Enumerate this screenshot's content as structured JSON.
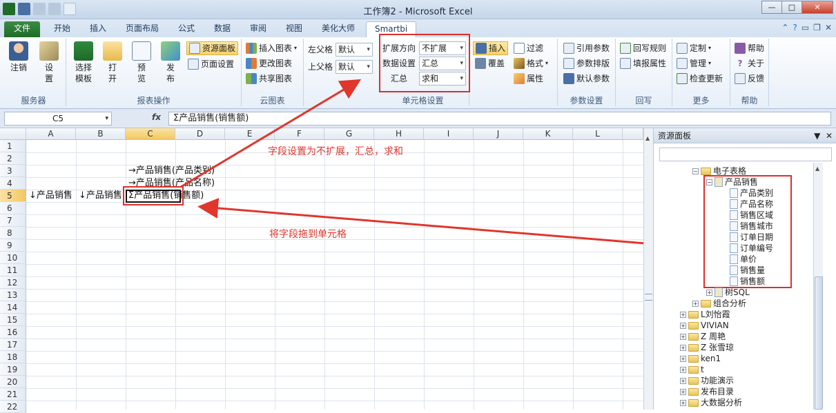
{
  "window": {
    "title": "工作簿2 - Microsoft Excel"
  },
  "tabs": [
    "文件",
    "开始",
    "插入",
    "页面布局",
    "公式",
    "数据",
    "审阅",
    "视图",
    "美化大师",
    "Smartbi"
  ],
  "ribbon": {
    "service": {
      "label": "服务器",
      "logout": "注销",
      "settings": "设\n置"
    },
    "report": {
      "label": "报表操作",
      "select_template": "选择\n模板",
      "open": "打\n开",
      "preview": "预\n览",
      "publish": "发\n布",
      "resource_panel": "资源面板",
      "page_settings": "页面设置"
    },
    "cloud": {
      "label": "云图表",
      "insert_chart": "插入图表",
      "change_chart": "更改图表",
      "share_chart": "共享图表"
    },
    "parent": {
      "left_parent": "左父格",
      "left_value": "默认",
      "top_parent": "上父格",
      "top_value": "默认"
    },
    "cell": {
      "label": "单元格设置",
      "expand_dir": "扩展方向",
      "expand_value": "不扩展",
      "data_setting": "数据设置",
      "data_value": "汇总",
      "summary": "汇总",
      "summary_value": "求和"
    },
    "misc": {
      "insert": "插入",
      "cover": "覆盖",
      "filter": "过滤",
      "format": "格式",
      "attribute": "属性"
    },
    "params": {
      "label": "参数设置",
      "ref_param": "引用参数",
      "param_layout": "参数排版",
      "default_param": "默认参数"
    },
    "writeback": {
      "label": "回写",
      "rules": "回写规则",
      "fill_attr": "填报属性"
    },
    "more": {
      "label": "更多",
      "custom": "定制",
      "manage": "管理",
      "check_update": "检查更新"
    },
    "help": {
      "label": "帮助",
      "help": "帮助",
      "about": "关于",
      "feedback": "反馈"
    }
  },
  "formula": {
    "name_box": "C5",
    "content": "Σ产品销售(销售额)"
  },
  "sheet": {
    "columns": [
      "A",
      "B",
      "C",
      "D",
      "E",
      "F",
      "G",
      "H",
      "I",
      "J",
      "K",
      "L"
    ],
    "rows": [
      "1",
      "2",
      "3",
      "4",
      "5",
      "6",
      "7",
      "8",
      "9",
      "10",
      "11",
      "12",
      "13",
      "14",
      "15",
      "16",
      "17",
      "18",
      "19",
      "20",
      "21",
      "22"
    ],
    "c3": "→产品销售(产品类别)",
    "c4": "→产品销售(产品名称)",
    "a5": "↓产品销售",
    "b5": "↓产品销售",
    "c5": "Σ产品销售(销售额)"
  },
  "annotations": {
    "top": "字段设置为不扩展，汇总，求和",
    "bottom": "将字段拖到单元格"
  },
  "panel": {
    "title": "资源面板",
    "tree": {
      "spreadsheet": "电子表格",
      "product_sales": "产品销售",
      "fields": [
        "产品类别",
        "产品名称",
        "销售区域",
        "销售城市",
        "订单日期",
        "订单编号",
        "单价",
        "销售量",
        "销售额"
      ],
      "tree_sql": "树SQL",
      "combo_analysis": "组合分析",
      "others": [
        "L刘怡霞",
        "VIVIAN",
        "Z 周艳",
        "Z 张雪琼",
        "ken1",
        "t",
        "功能演示",
        "发布目录",
        "大数据分析"
      ]
    }
  },
  "colors": {
    "accent_red": "#d9302c",
    "ribbon_highlight": "#f7d26a",
    "file_tab": "#1f6b28"
  }
}
